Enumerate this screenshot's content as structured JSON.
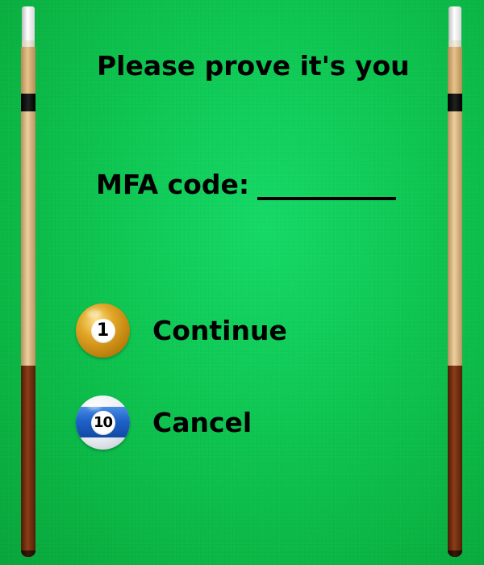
{
  "dialog": {
    "title": "Please prove it's you",
    "mfa_label": "MFA code:",
    "mfa_value": "",
    "mfa_placeholder": ""
  },
  "actions": [
    {
      "label": "Continue",
      "ball_number": "1",
      "ball_color": "#e0a526",
      "icon": "pool-ball-1-icon"
    },
    {
      "label": "Cancel",
      "ball_number": "10",
      "ball_color": "#1f62c8",
      "icon": "pool-ball-10-icon"
    }
  ],
  "theme": {
    "felt_color": "#0cc44f",
    "text_color": "#000000"
  }
}
